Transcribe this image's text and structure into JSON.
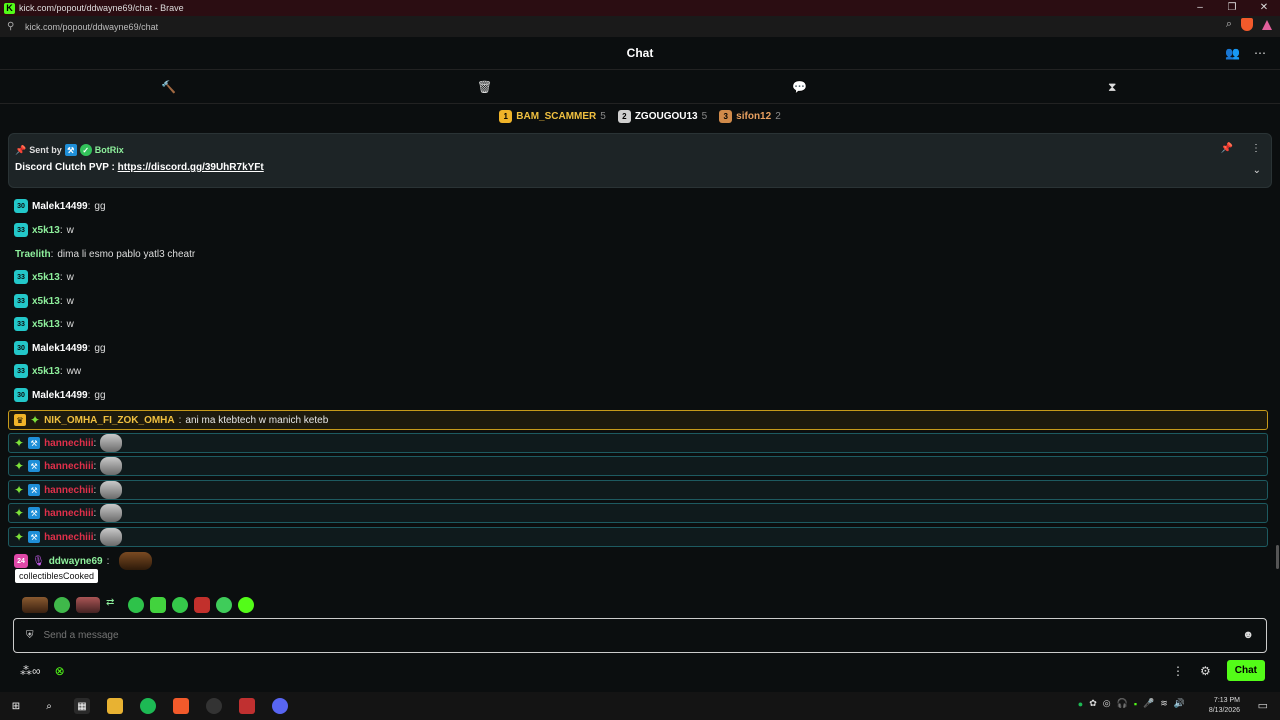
{
  "browser": {
    "window_title": "kick.com/popout/ddwayne69/chat - Brave",
    "url": "kick.com/popout/ddwayne69/chat"
  },
  "header": {
    "title": "Chat"
  },
  "leaderboard": [
    {
      "rank": "1",
      "name": "BAM_SCAMMER",
      "count": "5",
      "color": "#f0b429",
      "name_color": "#f0c040"
    },
    {
      "rank": "2",
      "name": "ZGOUGOU13",
      "count": "5",
      "color": "#cfcfcf",
      "name_color": "#ffffff"
    },
    {
      "rank": "3",
      "name": "sifon12",
      "count": "2",
      "color": "#d08a4a",
      "name_color": "#e8a060"
    }
  ],
  "pinned": {
    "sent_by_label": "Sent by",
    "sender": "BotRix",
    "message": "Discord Clutch PVP : ",
    "link": "https://discord.gg/39UhR7kYFt"
  },
  "messages": [
    {
      "badge": "30",
      "user": "Malek14499",
      "color": "#ffffff",
      "text": "gg"
    },
    {
      "badge": "33",
      "user": "x5k13",
      "color": "#8ef09c",
      "text": "w"
    },
    {
      "badge": "",
      "user": "Traelith",
      "color": "#8ef09c",
      "text": "dima li esmo pablo yatl3 cheatr"
    },
    {
      "badge": "33",
      "user": "x5k13",
      "color": "#8ef09c",
      "text": "w"
    },
    {
      "badge": "33",
      "user": "x5k13",
      "color": "#8ef09c",
      "text": "w"
    },
    {
      "badge": "33",
      "user": "x5k13",
      "color": "#8ef09c",
      "text": "w"
    },
    {
      "badge": "30",
      "user": "Malek14499",
      "color": "#ffffff",
      "text": "gg"
    },
    {
      "badge": "33",
      "user": "x5k13",
      "color": "#8ef09c",
      "text": "ww"
    },
    {
      "badge": "30",
      "user": "Malek14499",
      "color": "#ffffff",
      "text": "gg"
    }
  ],
  "highlight_message": {
    "user": "NIK_OMHA_FI_ZOK_OMHA",
    "text": "ani ma ktebtech w manich keteb",
    "color": "#f0c040"
  },
  "hanne_messages": [
    {
      "user": "hannechiii"
    },
    {
      "user": "hannechiii"
    },
    {
      "user": "hannechiii"
    },
    {
      "user": "hannechiii"
    },
    {
      "user": "hannechiii"
    }
  ],
  "last_message": {
    "badge": "24",
    "user": "ddwayne69"
  },
  "tooltip": "collectiblesCooked",
  "input": {
    "placeholder": "Send a message"
  },
  "chat_button": "Chat",
  "clock": {
    "time": "7:13 PM",
    "date": "8/13/2026"
  },
  "icons": {
    "mod_tools": [
      "gavel-icon",
      "trash-icon",
      "chat-bubble-icon",
      "hourglass-icon"
    ],
    "taskbar": [
      "windows-start-icon",
      "search-icon",
      "store-icon",
      "file-explorer-icon",
      "spotify-icon",
      "brave-icon",
      "obs-icon",
      "app-icon",
      "discord-icon"
    ]
  }
}
